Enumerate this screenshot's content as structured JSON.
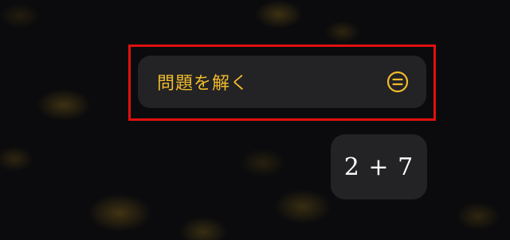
{
  "suggestion": {
    "label": "問題を解く",
    "icon": "equals-circle-icon",
    "accent_color": "#f2bb2c"
  },
  "highlight": {
    "color": "#e01010"
  },
  "expression": {
    "text": "2 + 7"
  }
}
